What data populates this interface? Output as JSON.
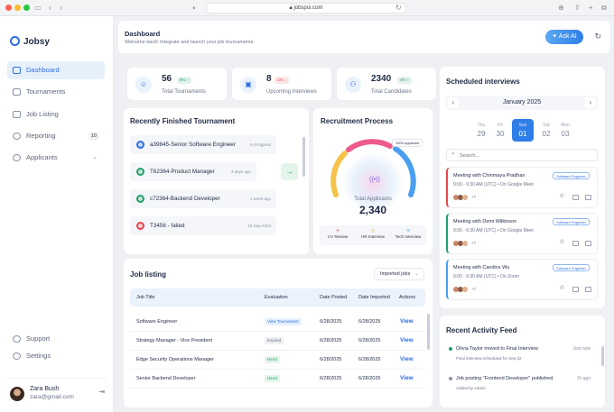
{
  "browser": {
    "url": "jobspui.com"
  },
  "brand": {
    "name": "Jobsy"
  },
  "sidebar": {
    "items": [
      {
        "label": "Dashboard",
        "active": true
      },
      {
        "label": "Tournaments"
      },
      {
        "label": "Job Listing"
      },
      {
        "label": "Reporting",
        "badge": "10"
      },
      {
        "label": "Applicants"
      }
    ],
    "bottom": [
      {
        "label": "Support"
      },
      {
        "label": "Settings"
      }
    ],
    "user": {
      "name": "Zara Bush",
      "email": "zara@gmail.com"
    }
  },
  "header": {
    "title": "Dashboard",
    "subtitle": "Welcome back! Integrate and launch your job tournaments.",
    "ask_ai": "Ask AI"
  },
  "stats": [
    {
      "value": "56",
      "pct": "8% ↑",
      "label": "Total Tournaments",
      "color": "#22a06b"
    },
    {
      "value": "8",
      "pct": "1% ↓",
      "label": "Upcoming Interviews",
      "color": "#e5484d"
    },
    {
      "value": "2340",
      "pct": "4% ↑",
      "label": "Total Candidates",
      "color": "#22a06b"
    }
  ],
  "tournaments": {
    "title": "Recently Finished Tournament",
    "rows": [
      {
        "name": "a39845-Senior Software Engineer",
        "meta": "In Progress",
        "color": "#2f6fe4"
      },
      {
        "name": "T62364-Product Manager",
        "meta": "3 days ago",
        "color": "#22a06b"
      },
      {
        "name": "c72364-Backend Developer",
        "meta": "1 week ago",
        "color": "#22a06b"
      },
      {
        "name": "T3456 - failed",
        "meta": "10 Sep 2023",
        "color": "#e5484d"
      }
    ]
  },
  "recruitment": {
    "title": "Recruitment Process",
    "badge": "1000 Applicant",
    "center_label": "Total Applicants",
    "center_value": "2,340",
    "legend": [
      {
        "label": "CV Review",
        "color": "#e5484d"
      },
      {
        "label": "HR Interview",
        "color": "#f5b83d"
      },
      {
        "label": "Tech Interview",
        "color": "#4a9ff0"
      }
    ]
  },
  "interviews": {
    "title": "Scheduled interviews",
    "month": "January 2025",
    "days": [
      {
        "dow": "Thu",
        "day": "29"
      },
      {
        "dow": "Fri",
        "day": "30"
      },
      {
        "dow": "Sun",
        "day": "01",
        "active": true
      },
      {
        "dow": "Sat",
        "day": "02"
      },
      {
        "dow": "Mon",
        "day": "03"
      }
    ],
    "search_placeholder": "Search...",
    "meetings": [
      {
        "title": "Meeting with Chinmaya Pradhan",
        "time": "9:00 - 9:30 AM (UTC) • On Google Meet",
        "tag": "Software Engineer",
        "more": "+7",
        "color": "#e5484d"
      },
      {
        "title": "Meeting with Demi Wilkinson",
        "time": "9:00 - 9:30 AM (UTC) • On Google Meet",
        "tag": "Software Engineer",
        "more": "+7",
        "color": "#22a06b"
      },
      {
        "title": "Meeting with Candice Wu",
        "time": "9:00 - 9:30 AM (UTC) • On Zoom",
        "tag": "Software Engineer",
        "more": "+7",
        "color": "#4a9ff0"
      }
    ]
  },
  "jobs": {
    "title": "Job listing",
    "filter": "Imported jobs",
    "columns": [
      "Job Title",
      "Evaluation",
      "Date Posted",
      "Date Imported",
      "Actions"
    ],
    "rows": [
      {
        "title": "Software Engineer",
        "eval": "View Tournament",
        "eval_color": "#2f6fe4",
        "eval_bg": "#e6f0fb",
        "posted": "6/28/2025",
        "imported": "6/28/2025",
        "action": "View"
      },
      {
        "title": "Strategy Manager - Vice President",
        "eval": "Expired",
        "eval_color": "#6b7489",
        "eval_bg": "#eef0f3",
        "posted": "6/28/2025",
        "imported": "6/28/2025",
        "action": "View"
      },
      {
        "title": "Edge Security Operations Manager",
        "eval": "Hired",
        "eval_color": "#22a06b",
        "eval_bg": "#e3f5ea",
        "posted": "6/28/2025",
        "imported": "6/28/2025",
        "action": "View"
      },
      {
        "title": "Senior Backend Developer",
        "eval": "Hired",
        "eval_color": "#22a06b",
        "eval_bg": "#e3f5ea",
        "posted": "6/28/2025",
        "imported": "6/28/2025",
        "action": "View"
      }
    ]
  },
  "activity": {
    "title": "Recent Activity Feed",
    "items": [
      {
        "text": "Olivia Taylor moved to Final Interview",
        "sub": "Final interview scheduled for Sep 22",
        "time": "Just now",
        "color": "#22a06b"
      },
      {
        "text": "Job posting \"Frontend Developer\" published",
        "sub": "Added by Admin",
        "time": "1h ago",
        "color": "#8a93a6"
      }
    ]
  }
}
